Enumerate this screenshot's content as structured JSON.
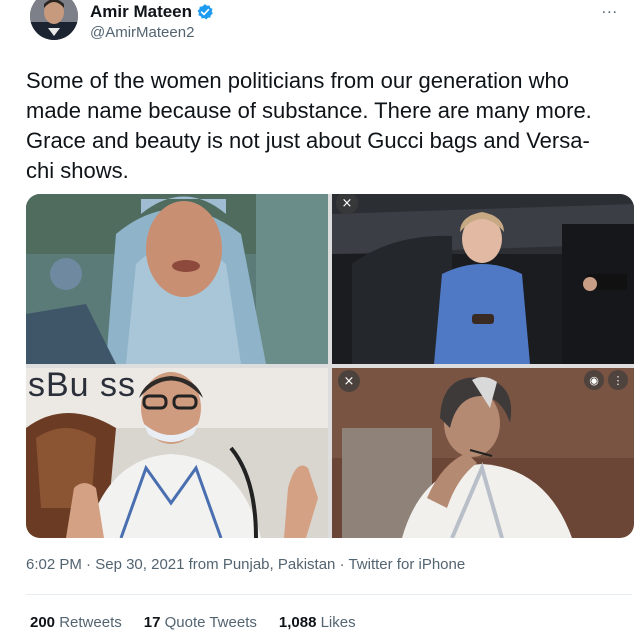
{
  "user": {
    "display_name": "Amir Mateen",
    "handle": "@AmirMateen2",
    "verified": true
  },
  "more_icon": "...",
  "tweet": {
    "text": "Some of the women politicians from our generation who made name because of substance. There are many more. Grace and beauty is not just about Gucci bags and Versa-chi shows."
  },
  "media": {
    "close_glyph": "×",
    "sign_text": "sBu   ss"
  },
  "meta": {
    "time": "6:02 PM",
    "date": "Sep 30, 2021",
    "from_label": "from",
    "location": "Punjab, Pakistan",
    "source": "Twitter for iPhone"
  },
  "stats": {
    "retweets_count": "200",
    "retweets_label": "Retweets",
    "quotes_count": "17",
    "quotes_label": "Quote Tweets",
    "likes_count": "1,088",
    "likes_label": "Likes"
  },
  "colors": {
    "verified_blue": "#1d9bf0",
    "secondary_text": "#536471"
  }
}
